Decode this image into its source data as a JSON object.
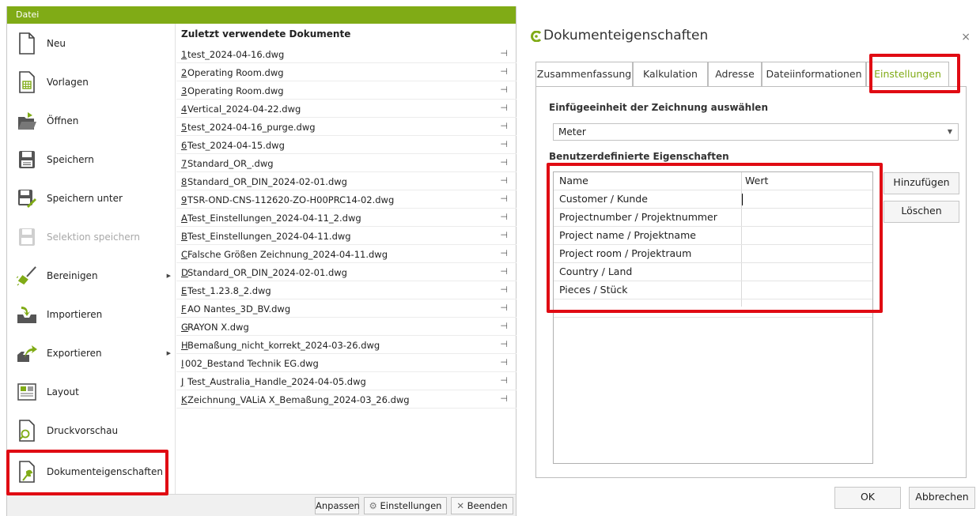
{
  "file_menu": {
    "header_title": "Datei",
    "items": [
      {
        "label": "Neu",
        "icon": "new-document-icon"
      },
      {
        "label": "Vorlagen",
        "icon": "templates-icon"
      },
      {
        "label": "Öffnen",
        "icon": "open-folder-icon"
      },
      {
        "label": "Speichern",
        "icon": "save-icon"
      },
      {
        "label": "Speichern unter",
        "icon": "save-as-icon"
      },
      {
        "label": "Selektion speichern",
        "icon": "save-selection-icon",
        "disabled": true
      },
      {
        "label": "Bereinigen",
        "icon": "broom-icon",
        "submenu": true
      },
      {
        "label": "Importieren",
        "icon": "import-icon"
      },
      {
        "label": "Exportieren",
        "icon": "export-icon",
        "submenu": true
      },
      {
        "label": "Layout",
        "icon": "layout-icon"
      },
      {
        "label": "Druckvorschau",
        "icon": "print-preview-icon"
      },
      {
        "label": "Dokumenteigenschaften",
        "icon": "document-properties-icon"
      }
    ],
    "recent_title": "Zuletzt verwendete Dokumente",
    "recent": [
      {
        "key": "1",
        "name": " test_2024-04-16.dwg"
      },
      {
        "key": "2",
        "name": " Operating Room.dwg"
      },
      {
        "key": "3",
        "name": " Operating Room.dwg"
      },
      {
        "key": "4",
        "name": " Vertical_2024-04-22.dwg"
      },
      {
        "key": "5",
        "name": " test_2024-04-16_purge.dwg"
      },
      {
        "key": "6",
        "name": " Test_2024-04-15.dwg"
      },
      {
        "key": "7",
        "name": " Standard_OR_.dwg"
      },
      {
        "key": "8",
        "name": " Standard_OR_DIN_2024-02-01.dwg"
      },
      {
        "key": "9",
        "name": " TSR-OND-CNS-112620-ZO-H00PRC14-02.dwg"
      },
      {
        "key": "A",
        "name": " Test_Einstellungen_2024-04-11_2.dwg"
      },
      {
        "key": "B",
        "name": " Test_Einstellungen_2024-04-11.dwg"
      },
      {
        "key": "C",
        "name": " Falsche Größen Zeichnung_2024-04-11.dwg"
      },
      {
        "key": "D",
        "name": " Standard_OR_DIN_2024-02-01.dwg"
      },
      {
        "key": "E",
        "name": " Test_1.23.8_2.dwg"
      },
      {
        "key": "F",
        "name": " AO Nantes_3D_BV.dwg"
      },
      {
        "key": "G",
        "name": " RAYON X.dwg"
      },
      {
        "key": "H",
        "name": " Bemaßung_nicht_korrekt_2024-03-26.dwg"
      },
      {
        "key": "I",
        "name": " 002_Bestand Technik EG.dwg"
      },
      {
        "key": "J",
        "name": " Test_Australia_Handle_2024-04-05.dwg"
      },
      {
        "key": "K",
        "name": " Zeichnung_VALiA X_Bemaßung_2024-03_26.dwg"
      }
    ],
    "pin_glyph": "⊣",
    "footer": {
      "customize": "Anpassen",
      "settings": "Einstellungen",
      "exit": "Beenden"
    }
  },
  "dialog": {
    "title": "Dokumenteigenschaften",
    "close_glyph": "×",
    "tabs": [
      "Zusammenfassung",
      "Kalkulation",
      "Adresse",
      "Dateiinformationen",
      "Einstellungen"
    ],
    "active_tab": "Einstellungen",
    "unit_section_label": "Einfügeeinheit der Zeichnung auswählen",
    "unit_value": "Meter",
    "custom_props_label": "Benutzerdefinierte Eigenschaften",
    "grid_headers": [
      "Name",
      "Wert"
    ],
    "grid_rows": [
      {
        "name": "Customer / Kunde",
        "value": ""
      },
      {
        "name": "Projectnumber / Projektnummer",
        "value": ""
      },
      {
        "name": "Project name / Projektname",
        "value": ""
      },
      {
        "name": "Project room / Projektraum",
        "value": ""
      },
      {
        "name": "Country / Land",
        "value": ""
      },
      {
        "name": "Pieces / Stück",
        "value": ""
      }
    ],
    "add_button": "Hinzufügen",
    "delete_button": "Löschen",
    "ok_button": "OK",
    "cancel_button": "Abbrechen"
  },
  "colors": {
    "accent_green": "#80ab16",
    "highlight_red": "#e00b13"
  }
}
